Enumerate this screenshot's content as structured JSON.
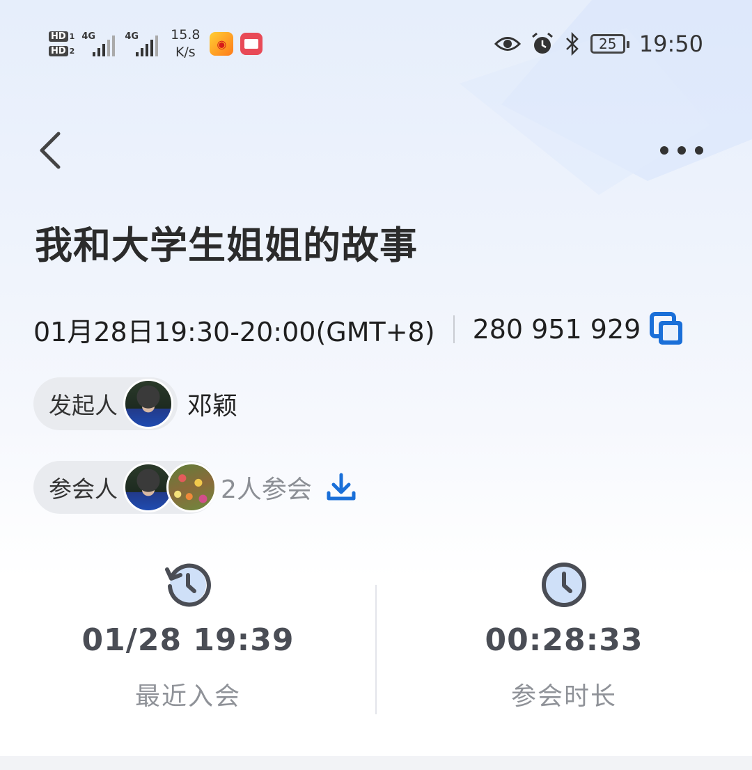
{
  "status_bar": {
    "sim1": "HD",
    "sim1_num": "1",
    "sim2": "HD",
    "sim2_num": "2",
    "net1": "4G",
    "net2": "4G",
    "speed_value": "15.8",
    "speed_unit": "K/s",
    "battery": "25",
    "time": "19:50",
    "icons": [
      "eye-icon",
      "alarm-icon",
      "bluetooth-icon"
    ]
  },
  "nav": {
    "back_icon": "chevron-left-icon",
    "more_icon": "more-horizontal-icon"
  },
  "meeting": {
    "title": "我和大学生姐姐的故事",
    "datetime": "01月28日19:30-20:00(GMT+8)",
    "meeting_id": "280 951 929"
  },
  "host": {
    "label": "发起人",
    "name": "邓颖"
  },
  "participants": {
    "label": "参会人",
    "count_text": "2人参会"
  },
  "stats": {
    "recent_join_value": "01/28 19:39",
    "recent_join_label": "最近入会",
    "duration_value": "00:28:33",
    "duration_label": "参会时长"
  },
  "colors": {
    "accent": "#1a6fd8",
    "icon_dark": "#4a4d55",
    "icon_fill": "#cfe0f8"
  }
}
